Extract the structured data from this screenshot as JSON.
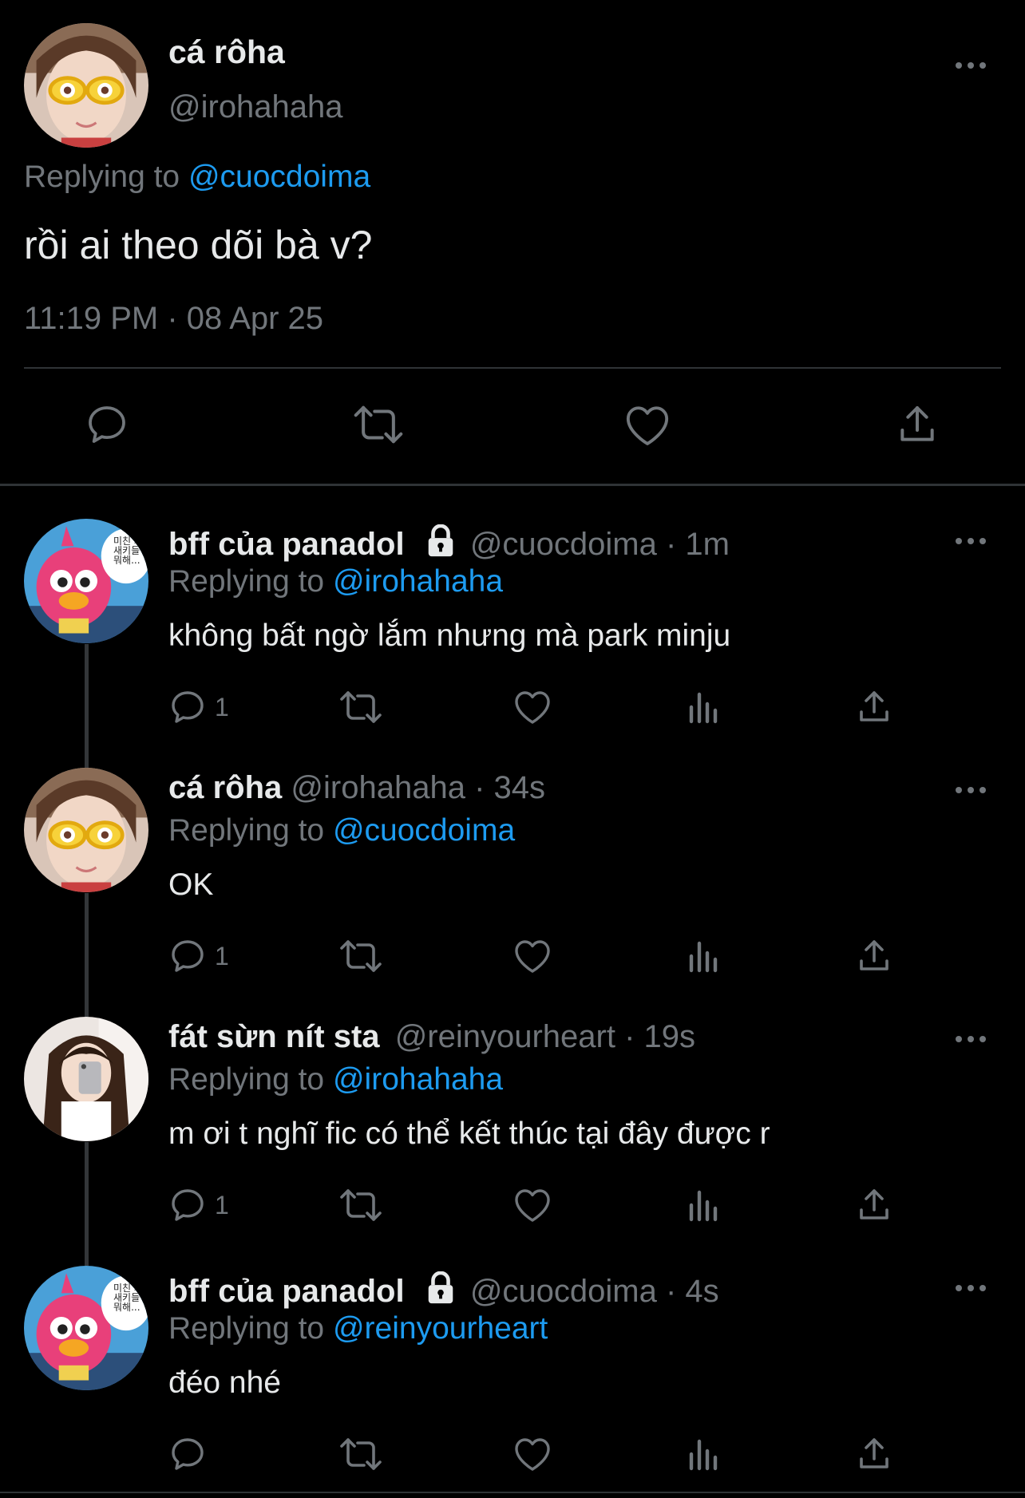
{
  "main_tweet": {
    "display_name": "cá rôha",
    "handle": "@irohahaha",
    "replying_prefix": "Replying to ",
    "replying_to": "@cuocdoima",
    "text": "rồi ai theo dõi bà v?",
    "timestamp": "11:19 PM · 08 Apr 25",
    "actions": [
      "reply-icon",
      "retweet-icon",
      "like-icon",
      "share-icon"
    ]
  },
  "replies": [
    {
      "display_name": "bff của panadol",
      "handle_time": "@cuocdoima · 1m",
      "locked": true,
      "replying_prefix": "Replying to ",
      "replying_to": "@irohahaha",
      "text": "không bất ngờ lắm nhưng mà park minju",
      "reply_count": "1"
    },
    {
      "display_name": "cá rôha",
      "handle_time": "@irohahaha · 34s",
      "locked": false,
      "replying_prefix": "Replying to ",
      "replying_to": "@cuocdoima",
      "text": "OK",
      "reply_count": "1"
    },
    {
      "display_name": "fát sừn nít sta",
      "handle_time": "@reinyourheart · 19s",
      "locked": false,
      "replying_prefix": "Replying to ",
      "replying_to": "@irohahaha",
      "text": "m ơi t nghĩ fic có thể kết thúc tại đây được r",
      "reply_count": "1"
    },
    {
      "display_name": "bff của panadol",
      "handle_time": "@cuocdoima · 4s",
      "locked": true,
      "replying_prefix": "Replying to ",
      "replying_to": "@reinyourheart",
      "text": "đéo nhé",
      "reply_count": ""
    }
  ],
  "avatar_sign_text": "미친 자\n새키들\n뭐해...",
  "colors": {
    "background": "#000000",
    "text": "#e7e9ea",
    "muted": "#71767b",
    "link": "#1d9bf0",
    "divider": "#2f3336"
  }
}
